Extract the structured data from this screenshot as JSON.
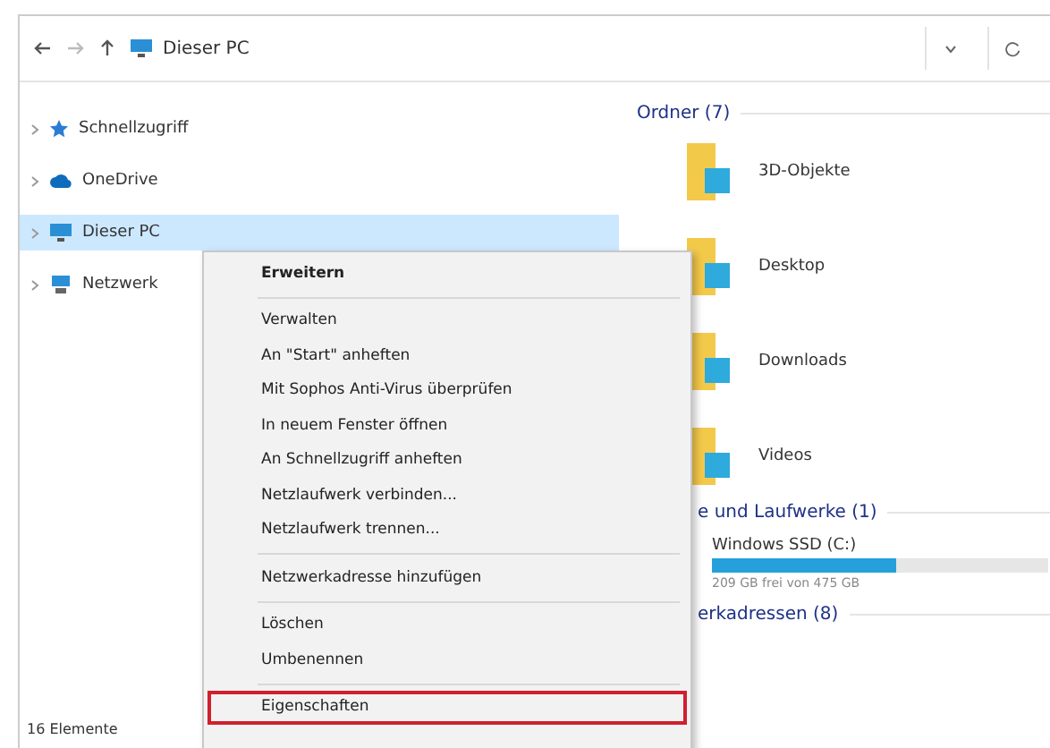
{
  "address_bar": {
    "path": "Dieser PC"
  },
  "sidebar": {
    "items": [
      {
        "label": "Schnellzugriff",
        "selected": false
      },
      {
        "label": "OneDrive",
        "selected": false
      },
      {
        "label": "Dieser PC",
        "selected": true
      },
      {
        "label": "Netzwerk",
        "selected": false
      }
    ]
  },
  "content": {
    "folders_heading": "Ordner (7)",
    "folders": [
      {
        "label": "3D-Objekte"
      },
      {
        "label": "Desktop"
      },
      {
        "label": "Downloads"
      },
      {
        "label": "Videos"
      }
    ],
    "drives_heading": "e und Laufwerke (1)",
    "drives": [
      {
        "label": "Windows SSD (C:)",
        "level": 0.55,
        "free": "209 GB frei von 475 GB"
      }
    ],
    "network_heading": "erkadressen (8)"
  },
  "context_menu": {
    "items": [
      {
        "kind": "item",
        "label": "Erweitern",
        "bold": true,
        "marked": false
      },
      {
        "kind": "separator"
      },
      {
        "kind": "item",
        "label": "Verwalten",
        "bold": false,
        "marked": false
      },
      {
        "kind": "item",
        "label": "An \"Start\" anheften",
        "bold": false,
        "marked": false
      },
      {
        "kind": "item",
        "label": "Mit Sophos Anti-Virus überprüfen",
        "bold": false,
        "marked": false
      },
      {
        "kind": "item",
        "label": "In neuem Fenster öffnen",
        "bold": false,
        "marked": false
      },
      {
        "kind": "item",
        "label": "An Schnellzugriff anheften",
        "bold": false,
        "marked": false
      },
      {
        "kind": "item",
        "label": "Netzlaufwerk verbinden...",
        "bold": false,
        "marked": false
      },
      {
        "kind": "item",
        "label": "Netzlaufwerk trennen...",
        "bold": false,
        "marked": false
      },
      {
        "kind": "separator"
      },
      {
        "kind": "item",
        "label": "Netzwerkadresse hinzufügen",
        "bold": false,
        "marked": false
      },
      {
        "kind": "separator"
      },
      {
        "kind": "item",
        "label": "Löschen",
        "bold": false,
        "marked": false
      },
      {
        "kind": "item",
        "label": "Umbenennen",
        "bold": false,
        "marked": false
      },
      {
        "kind": "separator"
      },
      {
        "kind": "item",
        "label": "Eigenschaften",
        "bold": false,
        "marked": true
      }
    ]
  },
  "status_bar": {
    "count": "16 Elemente"
  }
}
